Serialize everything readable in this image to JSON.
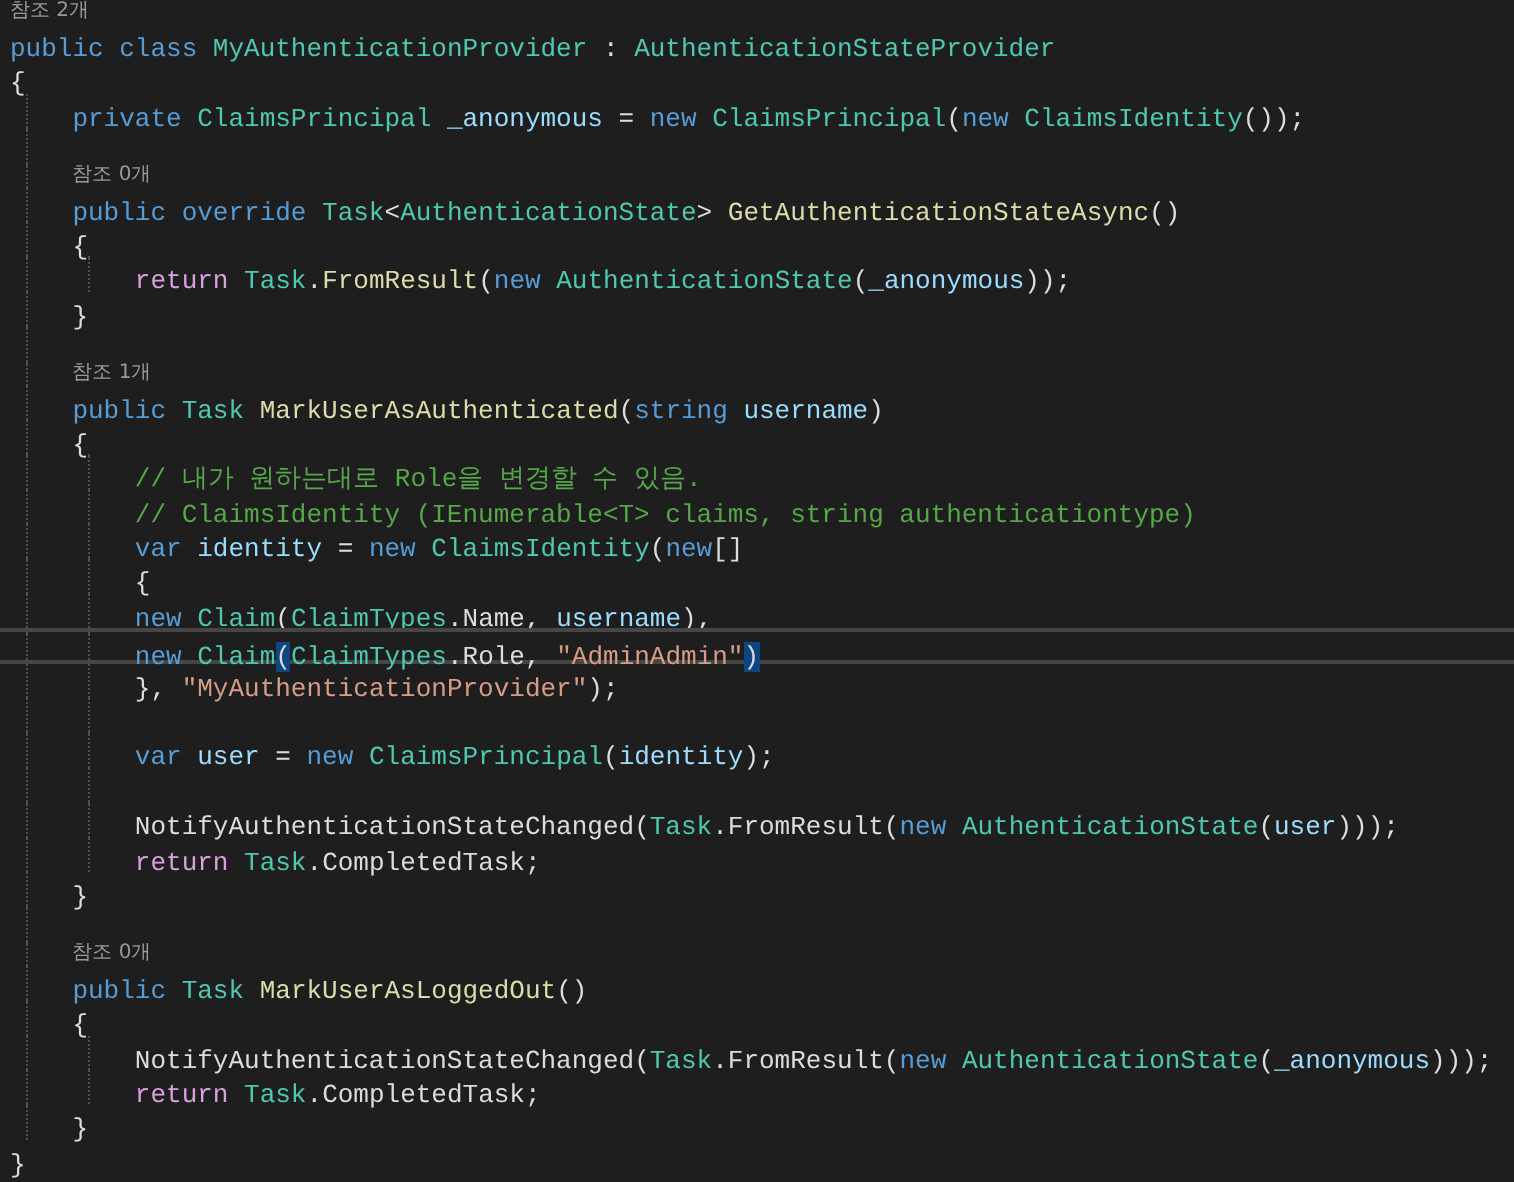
{
  "lines": [
    {
      "kind": "lens",
      "text": "참조 2개"
    },
    {
      "kind": "code",
      "tokens": [
        {
          "kind": "kw",
          "s": "public class "
        },
        {
          "kind": "type",
          "s": "MyAuthenticationProvider"
        },
        {
          "kind": "punc",
          "s": " : "
        },
        {
          "kind": "type",
          "s": "AuthenticationStateProvider"
        }
      ]
    },
    {
      "kind": "code",
      "tokens": [
        {
          "kind": "punc",
          "s": "{"
        }
      ]
    },
    {
      "kind": "code",
      "tokens": [
        {
          "kind": "kw",
          "s": "    private "
        },
        {
          "kind": "type",
          "s": "ClaimsPrincipal "
        },
        {
          "kind": "var",
          "s": "_anonymous"
        },
        {
          "kind": "punc",
          "s": " = "
        },
        {
          "kind": "kw",
          "s": "new "
        },
        {
          "kind": "type",
          "s": "ClaimsPrincipal"
        },
        {
          "kind": "punc",
          "s": "("
        },
        {
          "kind": "kw",
          "s": "new "
        },
        {
          "kind": "type",
          "s": "ClaimsIdentity"
        },
        {
          "kind": "punc",
          "s": "());"
        }
      ]
    },
    {
      "kind": "blank"
    },
    {
      "kind": "lens",
      "text": "참조 0개"
    },
    {
      "kind": "code",
      "tokens": [
        {
          "kind": "kw",
          "s": "    public override "
        },
        {
          "kind": "type",
          "s": "Task"
        },
        {
          "kind": "punc",
          "s": "<"
        },
        {
          "kind": "type",
          "s": "AuthenticationState"
        },
        {
          "kind": "punc",
          "s": "> "
        },
        {
          "kind": "method",
          "s": "GetAuthenticationStateAsync"
        },
        {
          "kind": "punc",
          "s": "()"
        }
      ]
    },
    {
      "kind": "code",
      "tokens": [
        {
          "kind": "punc",
          "s": "    {"
        }
      ]
    },
    {
      "kind": "code",
      "tokens": [
        {
          "kind": "ctrl",
          "s": "        return "
        },
        {
          "kind": "type",
          "s": "Task"
        },
        {
          "kind": "punc",
          "s": "."
        },
        {
          "kind": "method",
          "s": "FromResult"
        },
        {
          "kind": "punc",
          "s": "("
        },
        {
          "kind": "kw",
          "s": "new "
        },
        {
          "kind": "type",
          "s": "AuthenticationState"
        },
        {
          "kind": "punc",
          "s": "("
        },
        {
          "kind": "var",
          "s": "_anonymous"
        },
        {
          "kind": "punc",
          "s": "));"
        }
      ]
    },
    {
      "kind": "code",
      "tokens": [
        {
          "kind": "punc",
          "s": "    }"
        }
      ]
    },
    {
      "kind": "blank"
    },
    {
      "kind": "lens",
      "text": "참조 1개"
    },
    {
      "kind": "code",
      "tokens": [
        {
          "kind": "kw",
          "s": "    public "
        },
        {
          "kind": "type",
          "s": "Task "
        },
        {
          "kind": "method",
          "s": "MarkUserAsAuthenticated"
        },
        {
          "kind": "punc",
          "s": "("
        },
        {
          "kind": "kw",
          "s": "string "
        },
        {
          "kind": "var",
          "s": "username"
        },
        {
          "kind": "punc",
          "s": ")"
        }
      ]
    },
    {
      "kind": "code",
      "tokens": [
        {
          "kind": "punc",
          "s": "    {"
        }
      ]
    },
    {
      "kind": "code",
      "tokens": [
        {
          "kind": "comment",
          "s": "        // 내가 원하는대로 Role을 변경할 수 있음."
        }
      ]
    },
    {
      "kind": "code",
      "tokens": [
        {
          "kind": "comment",
          "s": "        // ClaimsIdentity (IEnumerable<T> claims, string authenticationtype)"
        }
      ]
    },
    {
      "kind": "code",
      "tokens": [
        {
          "kind": "kw",
          "s": "        var "
        },
        {
          "kind": "var",
          "s": "identity"
        },
        {
          "kind": "punc",
          "s": " = "
        },
        {
          "kind": "kw",
          "s": "new "
        },
        {
          "kind": "type",
          "s": "ClaimsIdentity"
        },
        {
          "kind": "punc",
          "s": "("
        },
        {
          "kind": "kw",
          "s": "new"
        },
        {
          "kind": "punc",
          "s": "[]"
        }
      ]
    },
    {
      "kind": "code",
      "tokens": [
        {
          "kind": "punc",
          "s": "        {"
        }
      ]
    },
    {
      "kind": "code",
      "tokens": [
        {
          "kind": "kw",
          "s": "        new "
        },
        {
          "kind": "type",
          "s": "Claim"
        },
        {
          "kind": "punc",
          "s": "("
        },
        {
          "kind": "type",
          "s": "ClaimTypes"
        },
        {
          "kind": "punc",
          "s": "."
        },
        {
          "kind": "plain",
          "s": "Name"
        },
        {
          "kind": "punc",
          "s": ", "
        },
        {
          "kind": "var",
          "s": "username"
        },
        {
          "kind": "punc",
          "s": "),"
        }
      ]
    },
    {
      "kind": "current",
      "tokens": [
        {
          "kind": "kw",
          "s": "        new "
        },
        {
          "kind": "type",
          "s": "Claim"
        },
        {
          "kind": "match",
          "s": "("
        },
        {
          "kind": "type",
          "s": "ClaimTypes"
        },
        {
          "kind": "punc",
          "s": "."
        },
        {
          "kind": "plain",
          "s": "Role"
        },
        {
          "kind": "punc",
          "s": ", "
        },
        {
          "kind": "str",
          "s": "\"AdminAdmin\""
        },
        {
          "kind": "match",
          "s": ")"
        }
      ]
    },
    {
      "kind": "code",
      "tokens": [
        {
          "kind": "punc",
          "s": "        }, "
        },
        {
          "kind": "str",
          "s": "\"MyAuthenticationProvider\""
        },
        {
          "kind": "punc",
          "s": ");"
        }
      ]
    },
    {
      "kind": "blank"
    },
    {
      "kind": "code",
      "tokens": [
        {
          "kind": "kw",
          "s": "        var "
        },
        {
          "kind": "var",
          "s": "user"
        },
        {
          "kind": "punc",
          "s": " = "
        },
        {
          "kind": "kw",
          "s": "new "
        },
        {
          "kind": "type",
          "s": "ClaimsPrincipal"
        },
        {
          "kind": "punc",
          "s": "("
        },
        {
          "kind": "var",
          "s": "identity"
        },
        {
          "kind": "punc",
          "s": ");"
        }
      ]
    },
    {
      "kind": "blank"
    },
    {
      "kind": "code",
      "tokens": [
        {
          "kind": "plain",
          "s": "        NotifyAuthenticationStateChanged"
        },
        {
          "kind": "punc",
          "s": "("
        },
        {
          "kind": "type",
          "s": "Task"
        },
        {
          "kind": "punc",
          "s": "."
        },
        {
          "kind": "plain",
          "s": "FromResult"
        },
        {
          "kind": "punc",
          "s": "("
        },
        {
          "kind": "kw",
          "s": "new "
        },
        {
          "kind": "type",
          "s": "AuthenticationState"
        },
        {
          "kind": "punc",
          "s": "("
        },
        {
          "kind": "var",
          "s": "user"
        },
        {
          "kind": "punc",
          "s": ")));"
        }
      ]
    },
    {
      "kind": "code",
      "tokens": [
        {
          "kind": "ctrl",
          "s": "        return "
        },
        {
          "kind": "type",
          "s": "Task"
        },
        {
          "kind": "punc",
          "s": "."
        },
        {
          "kind": "plain",
          "s": "CompletedTask"
        },
        {
          "kind": "punc",
          "s": ";"
        }
      ]
    },
    {
      "kind": "code",
      "tokens": [
        {
          "kind": "punc",
          "s": "    }"
        }
      ]
    },
    {
      "kind": "blank"
    },
    {
      "kind": "lens",
      "text": "참조 0개"
    },
    {
      "kind": "code",
      "tokens": [
        {
          "kind": "kw",
          "s": "    public "
        },
        {
          "kind": "type",
          "s": "Task "
        },
        {
          "kind": "method",
          "s": "MarkUserAsLoggedOut"
        },
        {
          "kind": "punc",
          "s": "()"
        }
      ]
    },
    {
      "kind": "code",
      "tokens": [
        {
          "kind": "punc",
          "s": "    {"
        }
      ]
    },
    {
      "kind": "code",
      "tokens": [
        {
          "kind": "plain",
          "s": "        NotifyAuthenticationStateChanged"
        },
        {
          "kind": "punc",
          "s": "("
        },
        {
          "kind": "type",
          "s": "Task"
        },
        {
          "kind": "punc",
          "s": "."
        },
        {
          "kind": "plain",
          "s": "FromResult"
        },
        {
          "kind": "punc",
          "s": "("
        },
        {
          "kind": "kw",
          "s": "new "
        },
        {
          "kind": "type",
          "s": "AuthenticationState"
        },
        {
          "kind": "punc",
          "s": "("
        },
        {
          "kind": "var",
          "s": "_anonymous"
        },
        {
          "kind": "punc",
          "s": ")));"
        }
      ]
    },
    {
      "kind": "code",
      "tokens": [
        {
          "kind": "ctrl",
          "s": "        return "
        },
        {
          "kind": "type",
          "s": "Task"
        },
        {
          "kind": "punc",
          "s": "."
        },
        {
          "kind": "plain",
          "s": "CompletedTask"
        },
        {
          "kind": "punc",
          "s": ";"
        }
      ]
    },
    {
      "kind": "code",
      "tokens": [
        {
          "kind": "punc",
          "s": "    }"
        }
      ]
    },
    {
      "kind": "code",
      "tokens": [
        {
          "kind": "punc",
          "s": "}"
        }
      ]
    }
  ]
}
